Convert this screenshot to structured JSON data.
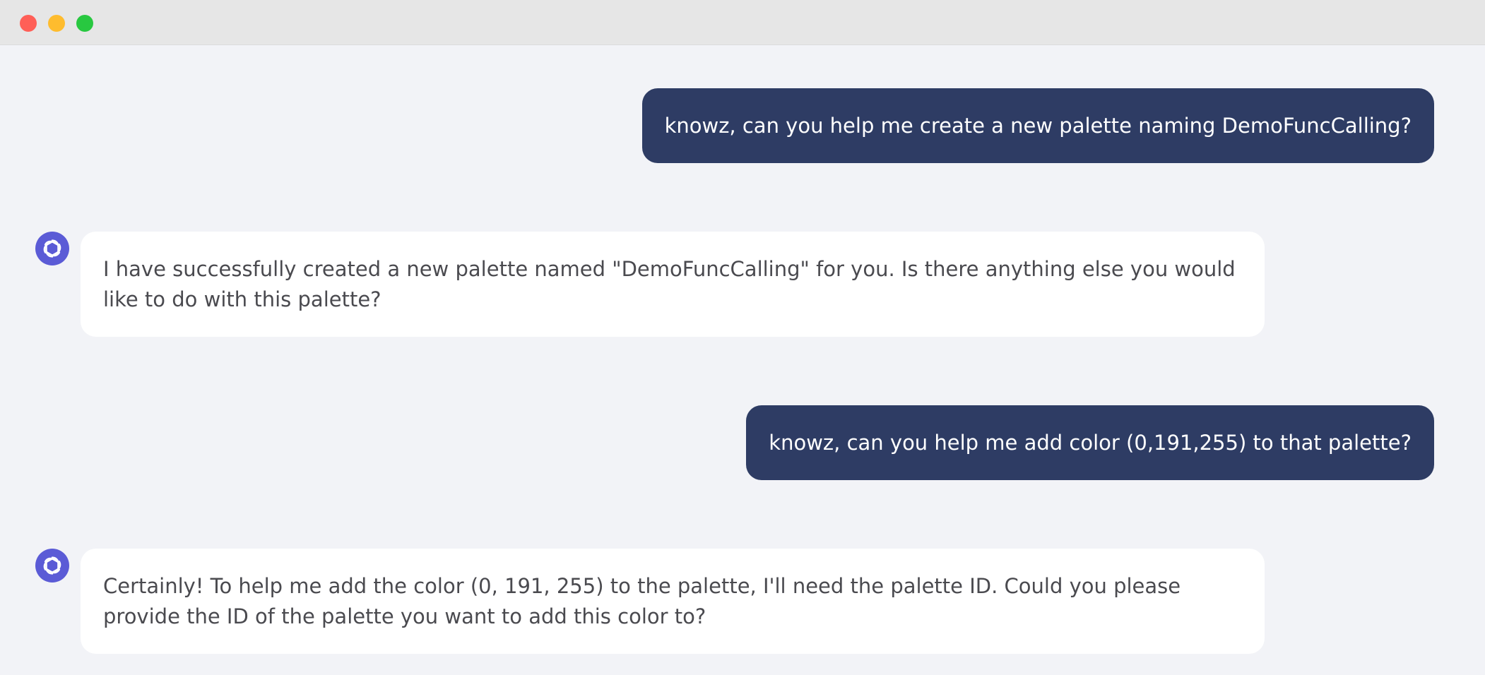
{
  "window": {
    "controls": [
      "close",
      "minimize",
      "maximize"
    ],
    "colors": {
      "close": "#ff5f57",
      "minimize": "#febc2e",
      "maximize": "#28c840"
    }
  },
  "theme": {
    "user_bubble": "#2e3c64",
    "assistant_bubble": "#ffffff",
    "background": "#f2f3f7",
    "avatar": "#5b5bd6"
  },
  "messages": [
    {
      "role": "user",
      "text": "knowz, can you help me create a new palette naming DemoFuncCalling?"
    },
    {
      "role": "assistant",
      "icon": "openai-logo-icon",
      "text": "I have successfully created a new palette named \"DemoFuncCalling\" for you. Is there anything else you would like to do with this palette?"
    },
    {
      "role": "user",
      "text": "knowz, can you help me add color (0,191,255) to that palette?"
    },
    {
      "role": "assistant",
      "icon": "openai-logo-icon",
      "text": "Certainly! To help me add the color (0, 191, 255) to the palette, I'll need the palette ID. Could you please provide the ID of the palette you want to add this color to?"
    }
  ]
}
